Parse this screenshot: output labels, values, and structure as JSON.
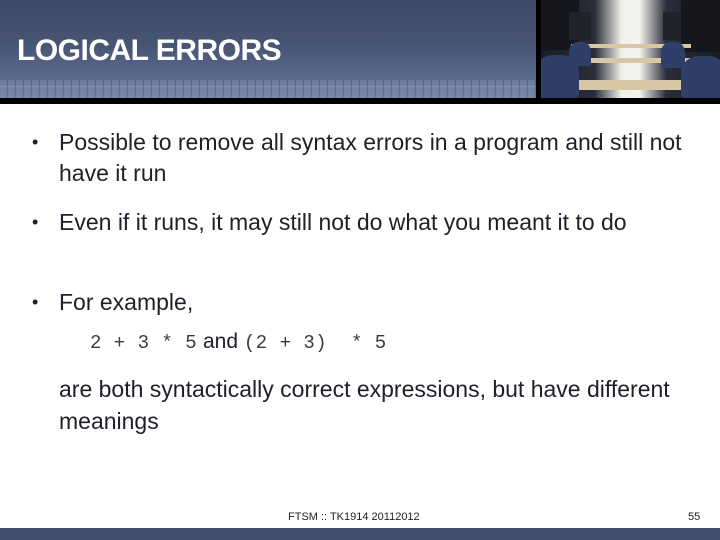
{
  "slide": {
    "title": "LOGICAL ERRORS",
    "bullets": [
      {
        "marker": "•",
        "text": "Possible to remove all syntax errors in a program and still not have it run"
      },
      {
        "marker": "•",
        "text": "Even if it runs, it may still not do what you meant it to do"
      },
      {
        "marker": "•",
        "text": "For example,"
      }
    ],
    "example": {
      "expr1": "2 + 3 * 5",
      "connector": "and",
      "expr2": "(2 + 3)  * 5"
    },
    "continuation": "are both syntactically correct expressions, but have different meanings"
  },
  "header_image": {
    "icon": "computer-lab-photo"
  },
  "footer": {
    "text": "FTSM :: TK1914 20112012",
    "page_number": "55"
  },
  "colors": {
    "header_band": "#475574",
    "bottom_bar": "#44506b",
    "title_text": "#ffffff",
    "body_text": "#1e1f2b"
  }
}
